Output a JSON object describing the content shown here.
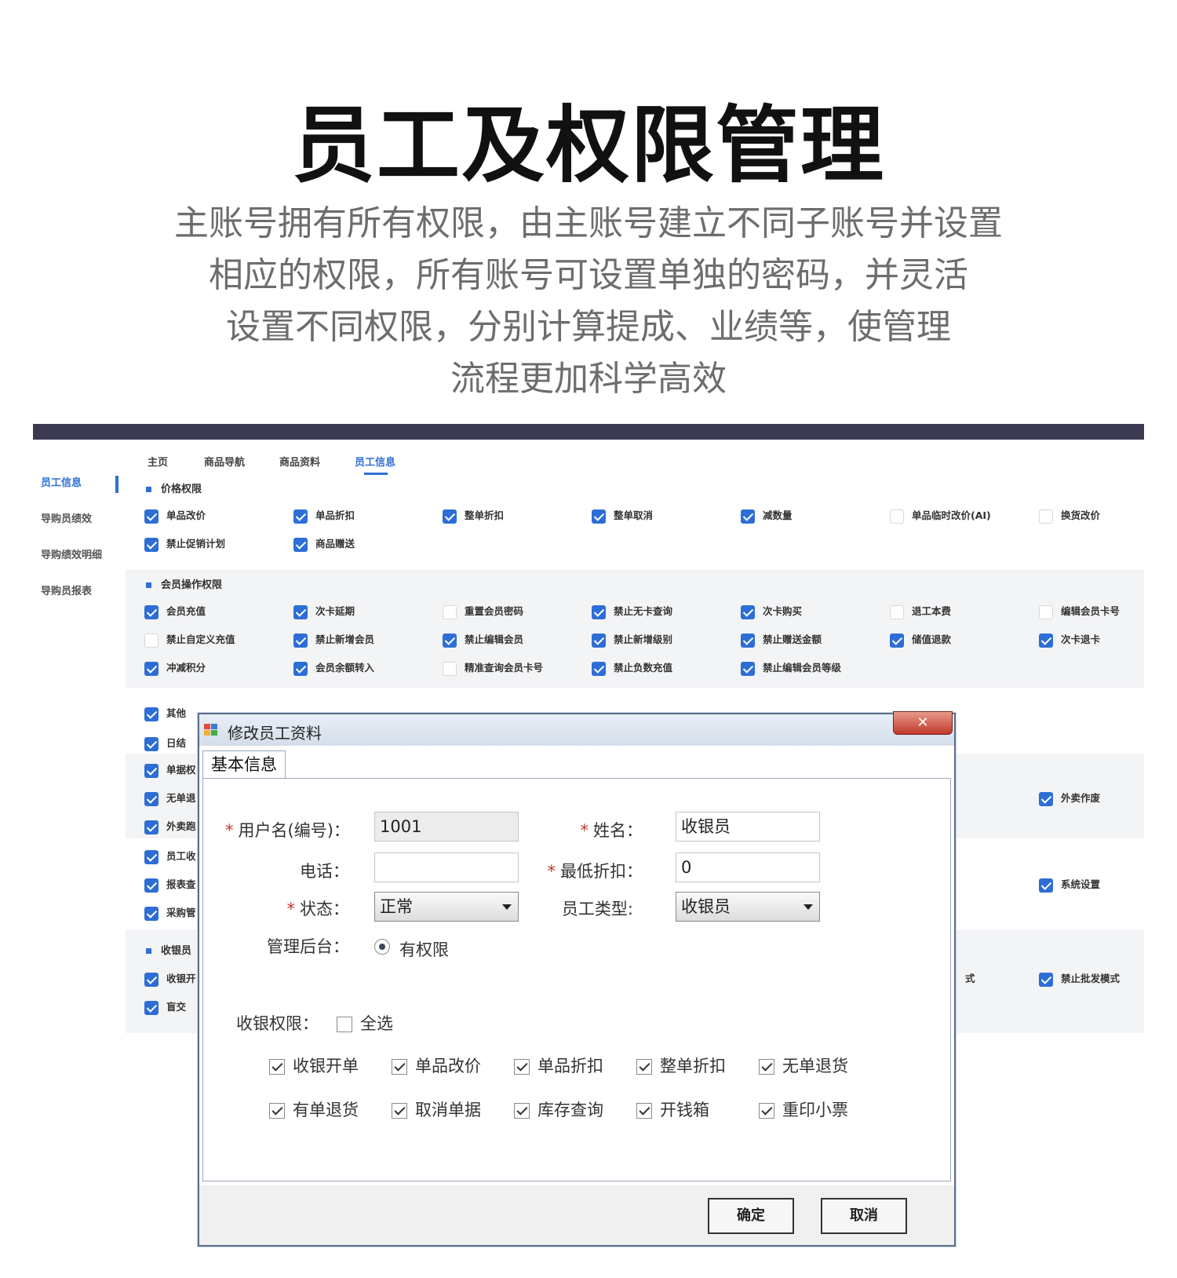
{
  "hero": {
    "title": "员工及权限管理",
    "desc_lines": [
      "主账号拥有所有权限，由主账号建立不同子账号并设置",
      "相应的权限，所有账号可设置单独的密码，并灵活",
      "设置不同权限，分别计算提成、业绩等，使管理",
      "流程更加科学高效"
    ]
  },
  "sidebar": {
    "items": [
      {
        "label": "员工信息"
      },
      {
        "label": "导购员绩效"
      },
      {
        "label": "导购绩效明细"
      },
      {
        "label": "导购员报表"
      }
    ]
  },
  "tabs": [
    {
      "label": "主页"
    },
    {
      "label": "商品导航"
    },
    {
      "label": "商品资料"
    },
    {
      "label": "员工信息"
    }
  ],
  "sections": {
    "price": {
      "title": "价格权限",
      "items": [
        {
          "label": "单品改价",
          "checked": true
        },
        {
          "label": "单品折扣",
          "checked": true
        },
        {
          "label": "整单折扣",
          "checked": true
        },
        {
          "label": "整单取消",
          "checked": true
        },
        {
          "label": "减数量",
          "checked": true
        },
        {
          "label": "单品临时改价(AI)",
          "checked": false
        },
        {
          "label": "换货改价",
          "checked": false
        },
        {
          "label": "禁止促销计划",
          "checked": true
        },
        {
          "label": "商品赠送",
          "checked": true
        }
      ]
    },
    "member": {
      "title": "会员操作权限",
      "items": [
        {
          "label": "会员充值",
          "checked": true
        },
        {
          "label": "次卡延期",
          "checked": true
        },
        {
          "label": "重置会员密码",
          "checked": false
        },
        {
          "label": "禁止无卡查询",
          "checked": true
        },
        {
          "label": "次卡购买",
          "checked": true
        },
        {
          "label": "退工本费",
          "checked": false
        },
        {
          "label": "编辑会员卡号",
          "checked": false
        },
        {
          "label": "禁止自定义充值",
          "checked": false
        },
        {
          "label": "禁止新增会员",
          "checked": true
        },
        {
          "label": "禁止编辑会员",
          "checked": true
        },
        {
          "label": "禁止新增级别",
          "checked": true
        },
        {
          "label": "禁止赠送金额",
          "checked": true
        },
        {
          "label": "储值退款",
          "checked": true
        },
        {
          "label": "次卡退卡",
          "checked": true
        },
        {
          "label": "冲减积分",
          "checked": true
        },
        {
          "label": "会员余额转入",
          "checked": true
        },
        {
          "label": "精准查询会员卡号",
          "checked": false
        },
        {
          "label": "禁止负数充值",
          "checked": true
        },
        {
          "label": "禁止编辑会员等级",
          "checked": true
        }
      ]
    },
    "other": {
      "items": [
        {
          "label": "其他",
          "checked": true
        },
        {
          "label": "日结",
          "checked": true
        }
      ]
    },
    "bill": {
      "items": [
        {
          "label": "单据权",
          "checked": true
        },
        {
          "label": "无单退",
          "checked": true
        },
        {
          "label": "外卖跑",
          "checked": true
        },
        {
          "label": "外卖作废",
          "checked": true
        }
      ]
    },
    "staff": {
      "items": [
        {
          "label": "员工收",
          "checked": true
        },
        {
          "label": "报表查",
          "checked": true
        },
        {
          "label": "采购管",
          "checked": true
        },
        {
          "label": "系统设置",
          "checked": true
        }
      ]
    },
    "cashier": {
      "title": "收银员",
      "items": [
        {
          "label": "收银开",
          "checked": true
        },
        {
          "label": "盲交",
          "checked": true
        },
        {
          "label": "式",
          "checked": false
        },
        {
          "label": "禁止批发模式",
          "checked": true
        }
      ]
    }
  },
  "dialog": {
    "title": "修改员工资料",
    "close_glyph": "✕",
    "tab": "基本信息",
    "fields": {
      "username_label": "用户名(编号)：",
      "username_value": "1001",
      "name_label": "姓名：",
      "name_value": "收银员",
      "phone_label": "电话：",
      "phone_value": "",
      "discount_label": "最低折扣：",
      "discount_value": "0",
      "status_label": "状态：",
      "status_value": "正常",
      "type_label": "员工类型:",
      "type_value": "收银员",
      "admin_label": "管理后台：",
      "admin_value": "有权限",
      "req_mark": "*"
    },
    "cashier_perm_label": "收银权限：",
    "select_all": "全选",
    "perms": [
      {
        "label": "收银开单",
        "checked": true
      },
      {
        "label": "单品改价",
        "checked": true
      },
      {
        "label": "单品折扣",
        "checked": true
      },
      {
        "label": "整单折扣",
        "checked": true
      },
      {
        "label": "无单退货",
        "checked": true
      },
      {
        "label": "有单退货",
        "checked": true
      },
      {
        "label": "取消单据",
        "checked": true
      },
      {
        "label": "库存查询",
        "checked": true
      },
      {
        "label": "开钱箱",
        "checked": true
      },
      {
        "label": "重印小票",
        "checked": true
      }
    ],
    "ok": "确定",
    "cancel": "取消"
  }
}
